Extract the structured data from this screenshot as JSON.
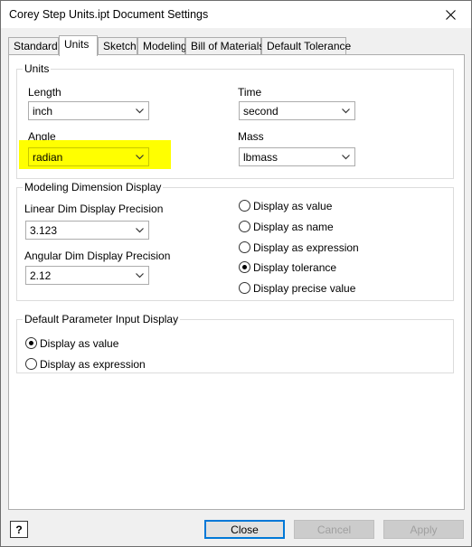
{
  "window": {
    "title": "Corey Step Units.ipt Document Settings"
  },
  "tabs": [
    {
      "label": "Standard",
      "active": false
    },
    {
      "label": "Units",
      "active": true
    },
    {
      "label": "Sketch",
      "active": false
    },
    {
      "label": "Modeling",
      "active": false
    },
    {
      "label": "Bill of Materials",
      "active": false
    },
    {
      "label": "Default Tolerance",
      "active": false
    }
  ],
  "units": {
    "group_label": "Units",
    "length_label": "Length",
    "length_value": "inch",
    "time_label": "Time",
    "time_value": "second",
    "angle_label": "Angle",
    "angle_value": "radian",
    "mass_label": "Mass",
    "mass_value": "lbmass",
    "highlight_color": "#ffff00"
  },
  "modeling_dimension": {
    "group_label": "Modeling Dimension Display",
    "linear_label": "Linear Dim Display Precision",
    "linear_value": "3.123",
    "angular_label": "Angular Dim Display Precision",
    "angular_value": "2.12",
    "options": [
      {
        "label": "Display as value",
        "selected": false
      },
      {
        "label": "Display as name",
        "selected": false
      },
      {
        "label": "Display as expression",
        "selected": false
      },
      {
        "label": "Display tolerance",
        "selected": true
      },
      {
        "label": "Display precise value",
        "selected": false
      }
    ]
  },
  "default_parameter": {
    "group_label": "Default Parameter Input Display",
    "options": [
      {
        "label": "Display as value",
        "selected": true
      },
      {
        "label": "Display as expression",
        "selected": false
      }
    ]
  },
  "buttons": {
    "help_icon": "question-icon",
    "close": "Close",
    "cancel": "Cancel",
    "apply": "Apply"
  }
}
